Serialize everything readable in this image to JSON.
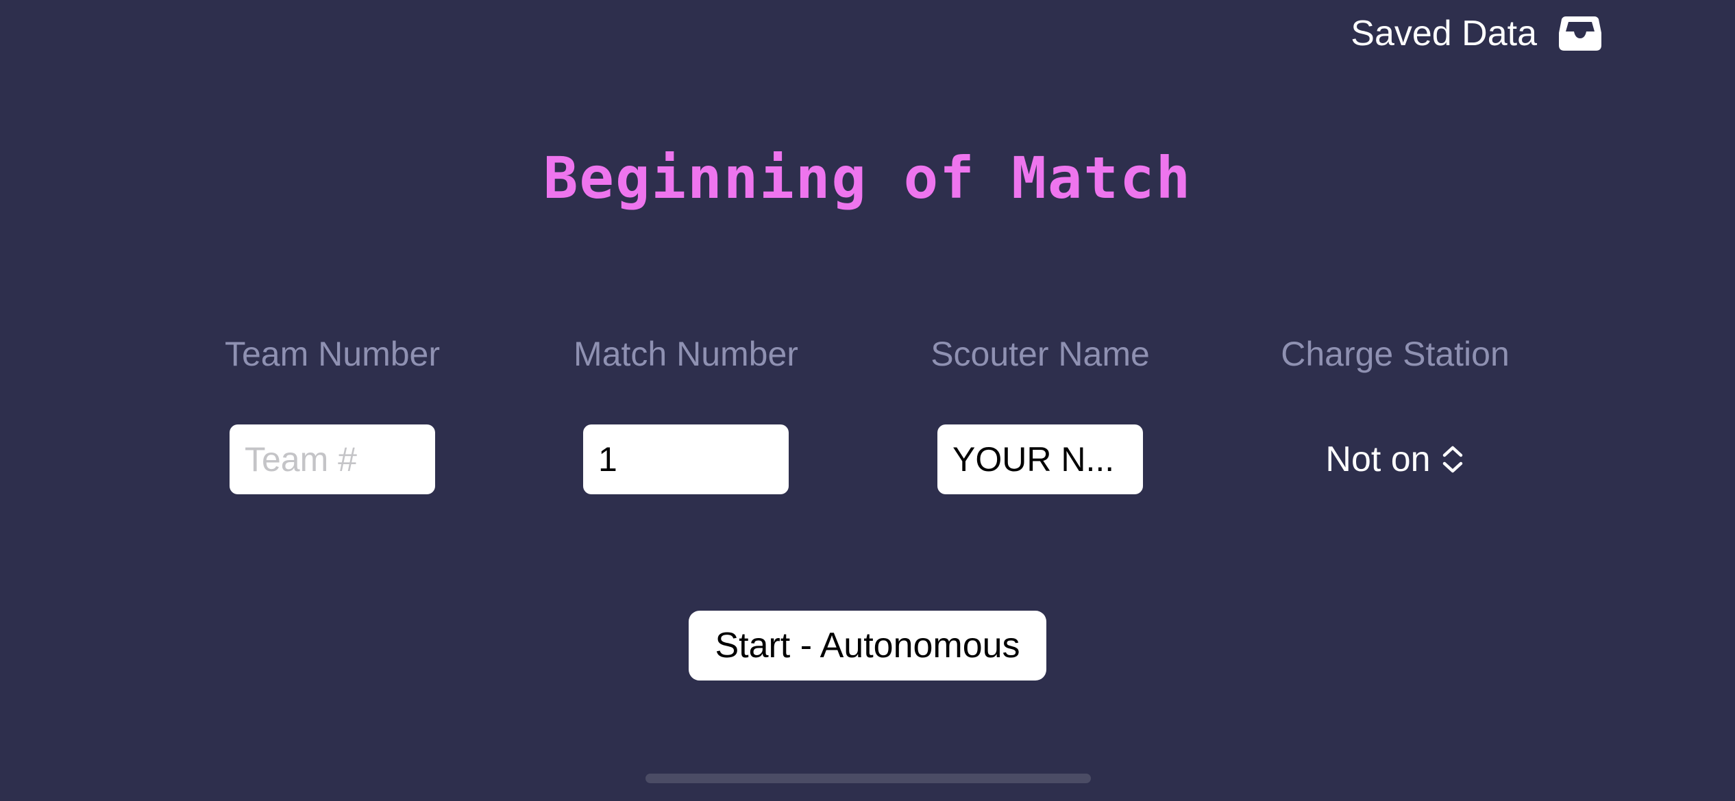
{
  "header": {
    "saved_data_label": "Saved Data",
    "saved_data_icon": "tray-icon"
  },
  "title": "Beginning of Match",
  "fields": {
    "team_number": {
      "label": "Team Number",
      "value": "",
      "placeholder": "Team #"
    },
    "match_number": {
      "label": "Match Number",
      "value": "1",
      "placeholder": ""
    },
    "scouter_name": {
      "label": "Scouter Name",
      "value": "YOUR N...",
      "placeholder": ""
    },
    "charge_station": {
      "label": "Charge Station",
      "selected": "Not on",
      "icon": "chevron-up-down-icon"
    }
  },
  "start_button_label": "Start - Autonomous",
  "colors": {
    "background": "#2e2f4d",
    "title": "#ee75ee",
    "label": "#8f91b2",
    "text": "#ffffff",
    "placeholder": "#c4c4c7"
  }
}
